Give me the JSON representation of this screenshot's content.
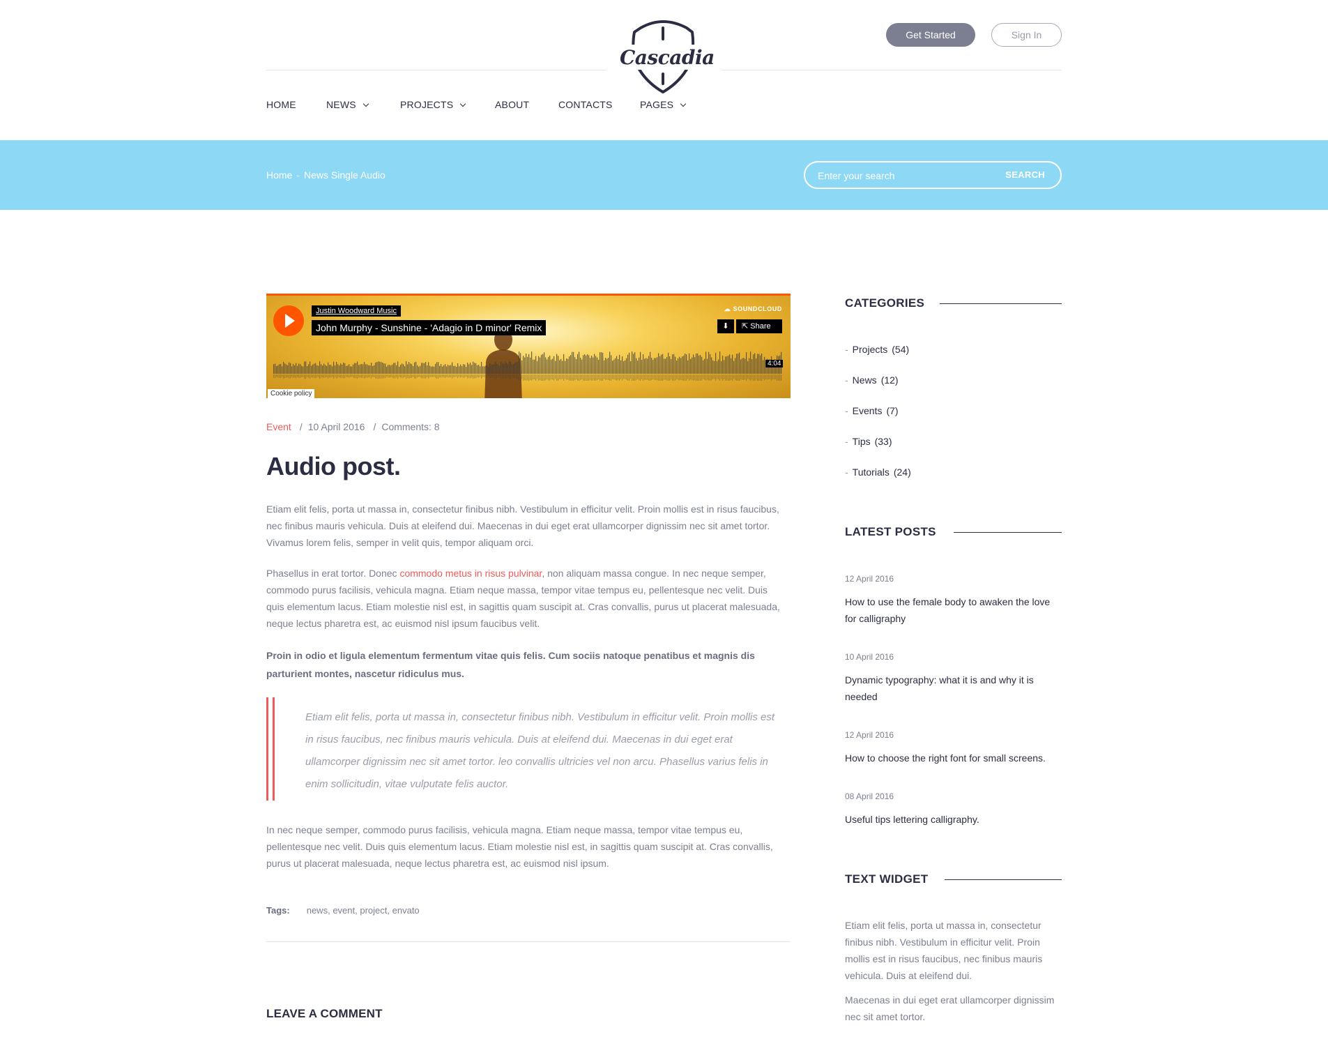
{
  "header": {
    "logo_text": "Cascadia",
    "get_started_label": "Get Started",
    "sign_in_label": "Sign In",
    "nav": [
      {
        "label": "HOME",
        "has_dropdown": false
      },
      {
        "label": "NEWS",
        "has_dropdown": true
      },
      {
        "label": "PROJECTS",
        "has_dropdown": true
      },
      {
        "label": "ABOUT",
        "has_dropdown": false
      },
      {
        "label": "CONTACTS",
        "has_dropdown": false
      },
      {
        "label": "PAGES",
        "has_dropdown": true
      }
    ]
  },
  "breadcrumb": {
    "home": "Home",
    "separator": "-",
    "current": "News Single Audio"
  },
  "search": {
    "placeholder": "Enter your search",
    "button_label": "SEARCH"
  },
  "player": {
    "artist": "Justin Woodward Music",
    "track": "John Murphy - Sunshine - 'Adagio in D minor' Remix",
    "brand": "SOUNDCLOUD",
    "share_label": "Share",
    "duration": "4:04",
    "cookie_label": "Cookie policy"
  },
  "post": {
    "category": "Event",
    "date": "10 April 2016",
    "comments": "Comments: 8",
    "title": "Audio post.",
    "para1": "Etiam elit felis, porta ut massa in, consectetur finibus nibh. Vestibulum in efficitur velit. Proin mollis est in risus faucibus, nec finibus mauris vehicula. Duis at eleifend dui. Maecenas in dui eget erat ullamcorper dignissim nec sit amet tortor. Vivamus lorem felis, semper in velit quis, tempor aliquam orci.",
    "para2_before": "Phasellus in erat tortor. Donec ",
    "para2_link": "commodo metus in risus pulvinar",
    "para2_after": ", non aliquam massa congue. In nec neque semper, commodo purus facilisis, vehicula magna. Etiam neque massa, tempor vitae tempus eu, pellentesque nec velit. Duis quis elementum lacus. Etiam molestie nisl est, in sagittis quam suscipit at. Cras convallis, purus ut placerat malesuada, neque lectus pharetra est, ac euismod nisl ipsum faucibus velit.",
    "para_bold": "Proin in odio et ligula elementum fermentum vitae quis felis. Cum sociis natoque penatibus et magnis dis parturient montes, nascetur ridiculus mus.",
    "quote": "Etiam elit felis, porta ut massa in, consectetur finibus nibh. Vestibulum in efficitur velit. Proin mollis est in risus faucibus, nec finibus mauris vehicula. Duis at eleifend dui. Maecenas in dui eget erat ullamcorper dignissim nec sit amet tortor. leo convallis ultricies vel non arcu. Phasellus varius felis in enim sollicitudin, vitae vulputate felis auctor.",
    "para3": "In nec neque semper, commodo purus facilisis, vehicula magna. Etiam neque massa, tempor vitae tempus eu, pellentesque nec velit. Duis quis elementum lacus. Etiam molestie nisl est, in sagittis quam suscipit at. Cras convallis, purus ut placerat malesuada, neque lectus pharetra est, ac euismod nisl ipsum.",
    "tags_label": "Tags:",
    "tags": [
      "news",
      "event",
      "project",
      "envato"
    ],
    "leave_comment": "LEAVE A COMMENT"
  },
  "sidebar": {
    "categories_title": "CATEGORIES",
    "categories": [
      {
        "name": "Projects",
        "count": "(54)"
      },
      {
        "name": "News",
        "count": "(12)"
      },
      {
        "name": "Events",
        "count": "(7)"
      },
      {
        "name": "Tips",
        "count": "(33)"
      },
      {
        "name": "Tutorials",
        "count": "(24)"
      }
    ],
    "latest_title": "LATEST POSTS",
    "latest": [
      {
        "date": "12 April 2016",
        "title": "How to use the female body to awaken the love for calligraphy"
      },
      {
        "date": "10 April 2016",
        "title": "Dynamic typography: what it is and why it is needed"
      },
      {
        "date": "12 April 2016",
        "title": "How to choose the right font for small screens."
      },
      {
        "date": "08 April 2016",
        "title": "Useful tips lettering calligraphy."
      }
    ],
    "text_widget_title": "TEXT WIDGET",
    "text_widget_p1": "Etiam elit felis, porta ut massa in, consectetur finibus nibh. Vestibulum in efficitur velit. Proin mollis est in risus faucibus, nec finibus mauris vehicula. Duis at eleifend dui.",
    "text_widget_p2": "Maecenas in dui eget erat ullamcorper dignissim nec sit amet tortor."
  },
  "colors": {
    "accent": "#f05a5a",
    "band": "#8dd9f5",
    "dark": "#2b2d42",
    "muted": "#7c7f91",
    "soundcloud": "#ff5500"
  }
}
